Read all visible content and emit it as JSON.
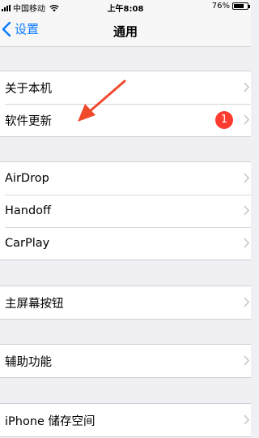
{
  "status_bar": {
    "carrier": "中国移动",
    "time": "上午8:08",
    "battery": "76%",
    "battery_level": 0.76
  },
  "nav": {
    "back_label": "设置",
    "title": "通用"
  },
  "groups": [
    {
      "items": [
        {
          "label": "关于本机"
        },
        {
          "label": "软件更新",
          "badge": "1"
        }
      ]
    },
    {
      "items": [
        {
          "label": "AirDrop"
        },
        {
          "label": "Handoff"
        },
        {
          "label": "CarPlay"
        }
      ]
    },
    {
      "items": [
        {
          "label": "主屏幕按钮"
        }
      ]
    },
    {
      "items": [
        {
          "label": "辅助功能"
        }
      ]
    },
    {
      "items": [
        {
          "label": "iPhone 储存空间"
        }
      ]
    }
  ],
  "colors": {
    "accent": "#0a7aff",
    "badge": "#ff3b30",
    "annotation_arrow": "#f04a2c",
    "background": "#efeff4"
  },
  "icons": [
    "signal-icon",
    "wifi-icon",
    "battery-icon",
    "back-chevron-icon",
    "chevron-right-icon",
    "annotation-arrow-icon"
  ]
}
